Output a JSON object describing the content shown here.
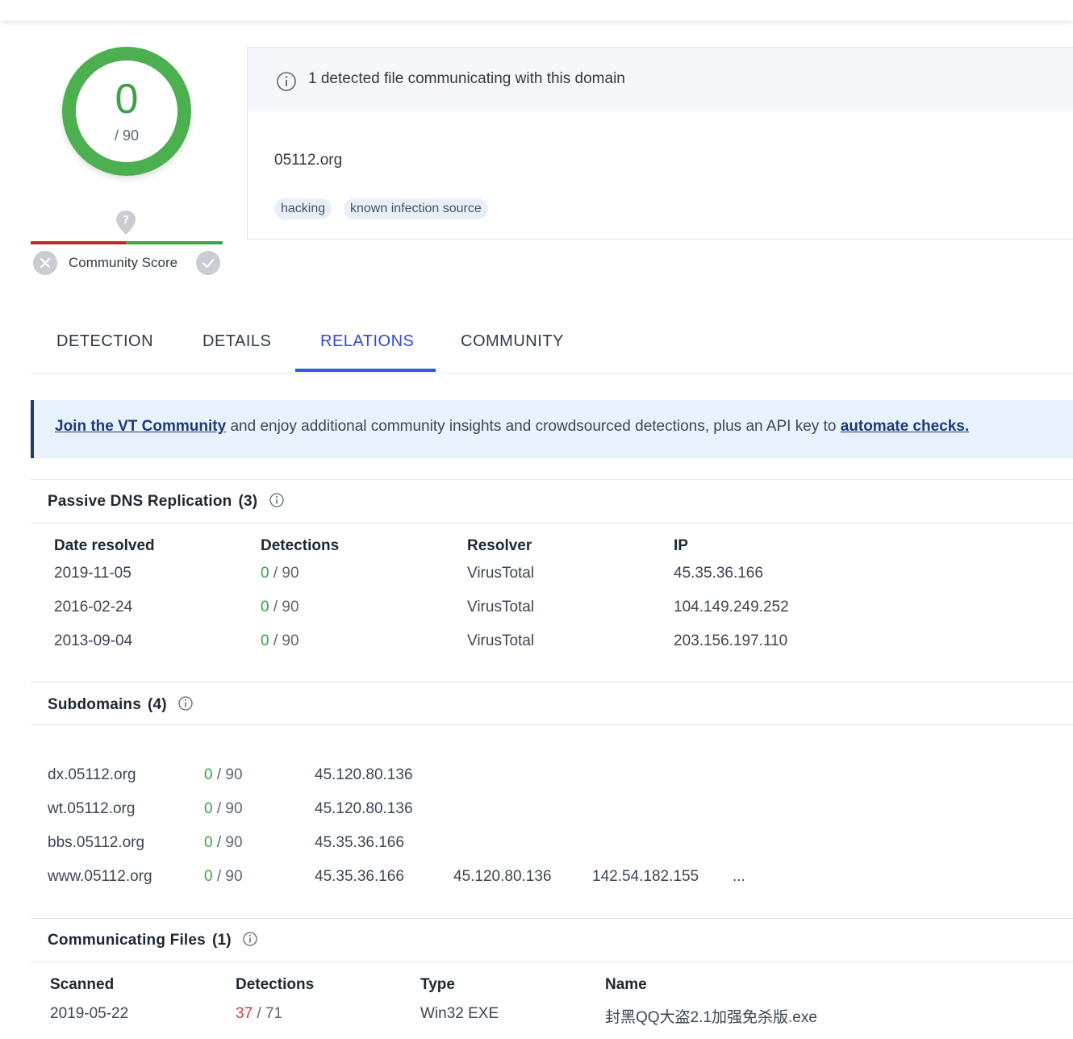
{
  "score": {
    "value": "0",
    "total": "/ 90"
  },
  "community": {
    "label": "Community Score"
  },
  "detected_card": {
    "title": "1 detected file communicating with this domain",
    "domain": "05112.org",
    "tags": [
      "hacking",
      "known infection source"
    ]
  },
  "tabs": [
    {
      "label": "DETECTION"
    },
    {
      "label": "DETAILS"
    },
    {
      "label": "RELATIONS",
      "active": true
    },
    {
      "label": "COMMUNITY"
    }
  ],
  "banner": {
    "link1": "Join the VT Community",
    "middle": " and enjoy additional community insights and crowdsourced detections, plus an API key to ",
    "link2": "automate checks."
  },
  "passive_dns": {
    "title": "Passive DNS Replication",
    "count": "(3)",
    "headers": [
      "Date resolved",
      "Detections",
      "Resolver",
      "IP"
    ],
    "rows": [
      {
        "date": "2019-11-05",
        "det": "0",
        "total": "/ 90",
        "resolver": "VirusTotal",
        "ip": "45.35.36.166"
      },
      {
        "date": "2016-02-24",
        "det": "0",
        "total": "/ 90",
        "resolver": "VirusTotal",
        "ip": "104.149.249.252"
      },
      {
        "date": "2013-09-04",
        "det": "0",
        "total": "/ 90",
        "resolver": "VirusTotal",
        "ip": "203.156.197.110"
      }
    ]
  },
  "subdomains": {
    "title": "Subdomains",
    "count": "(4)",
    "rows": [
      {
        "name": "dx.05112.org",
        "det": "0",
        "total": "/ 90",
        "ips": [
          "45.120.80.136"
        ]
      },
      {
        "name": "wt.05112.org",
        "det": "0",
        "total": "/ 90",
        "ips": [
          "45.120.80.136"
        ]
      },
      {
        "name": "bbs.05112.org",
        "det": "0",
        "total": "/ 90",
        "ips": [
          "45.35.36.166"
        ]
      },
      {
        "name": "www.05112.org",
        "det": "0",
        "total": "/ 90",
        "ips": [
          "45.35.36.166",
          "45.120.80.136",
          "142.54.182.155",
          "..."
        ]
      }
    ]
  },
  "communicating_files": {
    "title": "Communicating Files",
    "count": "(1)",
    "headers": [
      "Scanned",
      "Detections",
      "Type",
      "Name"
    ],
    "rows": [
      {
        "scanned": "2019-05-22",
        "det": "37",
        "total": "/ 71",
        "type": "Win32 EXE",
        "name": "封黑QQ大盗2.1加强免杀版.exe"
      }
    ]
  },
  "colors": {
    "accent": "#2f55e4",
    "clean": "#3aa347",
    "malicious": "#d23c3c",
    "ring": "#4caf50"
  }
}
